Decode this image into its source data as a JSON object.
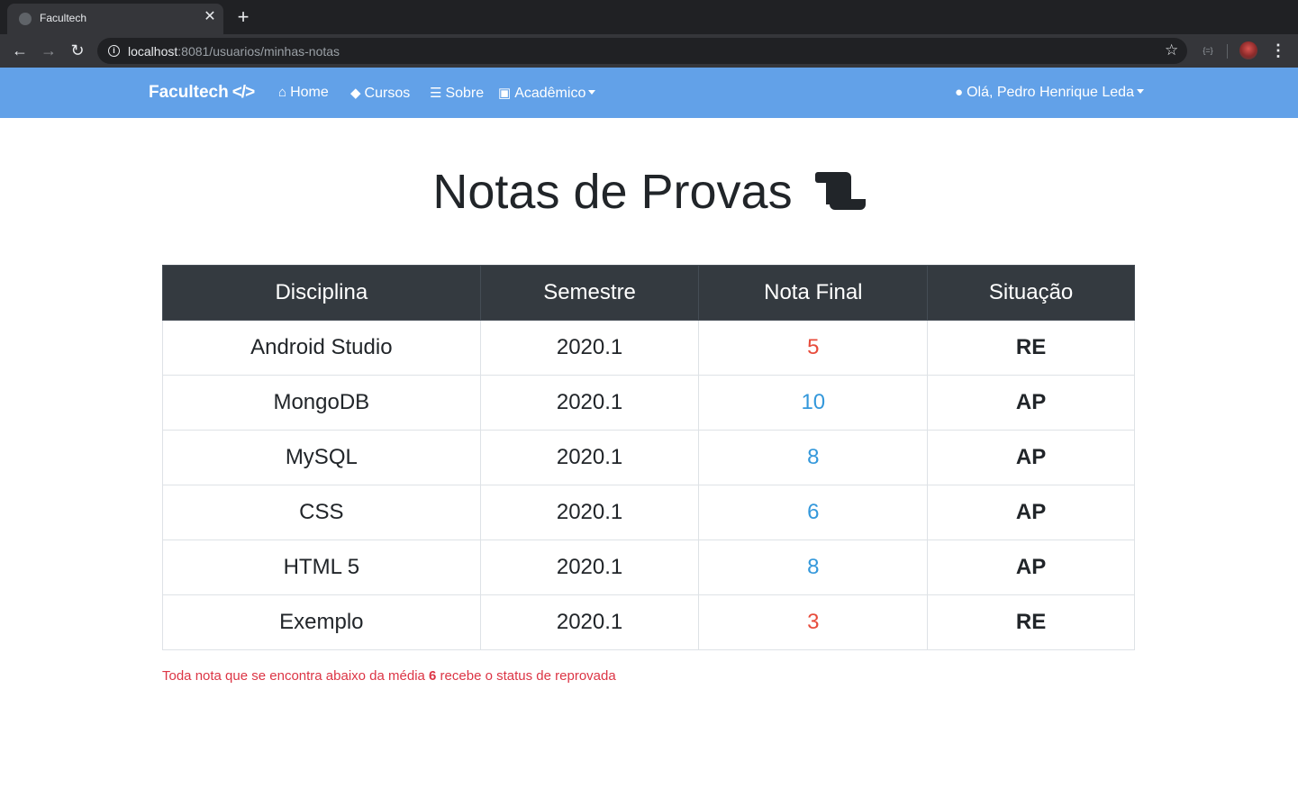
{
  "browser": {
    "tab_title": "Facultech",
    "url_host": "localhost",
    "url_rest": ":8081/usuarios/minhas-notas"
  },
  "navbar": {
    "brand": "Facultech",
    "brand_icon": "</>",
    "items": [
      {
        "label": "Home",
        "icon": "home-icon"
      },
      {
        "label": "Cursos",
        "icon": "graduation-cap-icon"
      },
      {
        "label": "Sobre",
        "icon": "list-icon"
      },
      {
        "label": "Acadêmico",
        "icon": "reader-icon"
      }
    ],
    "user_greeting": "Olá, Pedro Henrique Leda"
  },
  "page": {
    "title": "Notas de Provas"
  },
  "table": {
    "headers": [
      "Disciplina",
      "Semestre",
      "Nota Final",
      "Situação"
    ],
    "rows": [
      {
        "disciplina": "Android Studio",
        "semestre": "2020.1",
        "nota": "5",
        "situacao": "RE"
      },
      {
        "disciplina": "MongoDB",
        "semestre": "2020.1",
        "nota": "10",
        "situacao": "AP"
      },
      {
        "disciplina": "MySQL",
        "semestre": "2020.1",
        "nota": "8",
        "situacao": "AP"
      },
      {
        "disciplina": "CSS",
        "semestre": "2020.1",
        "nota": "6",
        "situacao": "AP"
      },
      {
        "disciplina": "HTML 5",
        "semestre": "2020.1",
        "nota": "8",
        "situacao": "AP"
      },
      {
        "disciplina": "Exemplo",
        "semestre": "2020.1",
        "nota": "3",
        "situacao": "RE"
      }
    ]
  },
  "footnote": {
    "before": "Toda nota que se encontra abaixo da média ",
    "threshold": "6",
    "after": " recebe o status de reprovada"
  },
  "colors": {
    "navbar": "#62a1e8",
    "table_header": "#343a40",
    "grade_fail": "#e74c3c",
    "grade_pass": "#3498db",
    "footnote": "#dc3545"
  }
}
